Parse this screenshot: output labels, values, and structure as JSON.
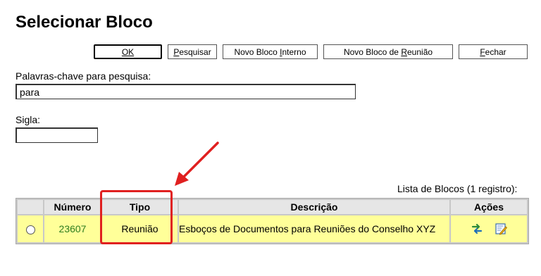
{
  "title": "Selecionar Bloco",
  "buttons": {
    "ok": {
      "label": "OK",
      "u": "O",
      "rest": "K"
    },
    "pesquisar": {
      "u": "P",
      "rest": "esquisar"
    },
    "interno": {
      "pre": "Novo Bloco ",
      "u": "I",
      "rest": "nterno"
    },
    "reuniao": {
      "pre": "Novo Bloco de ",
      "u": "R",
      "rest": "eunião"
    },
    "fechar": {
      "u": "F",
      "rest": "echar"
    }
  },
  "search": {
    "label": "Palavras-chave para pesquisa:",
    "value": "para"
  },
  "sigla": {
    "label": "Sigla:",
    "value": ""
  },
  "table": {
    "caption": "Lista de Blocos (1 registro):",
    "headers": {
      "numero": "Número",
      "tipo": "Tipo",
      "descricao": "Descrição",
      "acoes": "Ações"
    },
    "rows": [
      {
        "numero": "23607",
        "tipo": "Reunião",
        "descricao": "Esboços de Documentos para Reuniões do Conselho XYZ"
      }
    ]
  },
  "icons": {
    "transport": "transport-arrows-icon",
    "edit": "edit-document-icon"
  },
  "colors": {
    "highlight": "#e02020",
    "row_bg": "#ffff99",
    "number_text": "#2e7d1f"
  }
}
